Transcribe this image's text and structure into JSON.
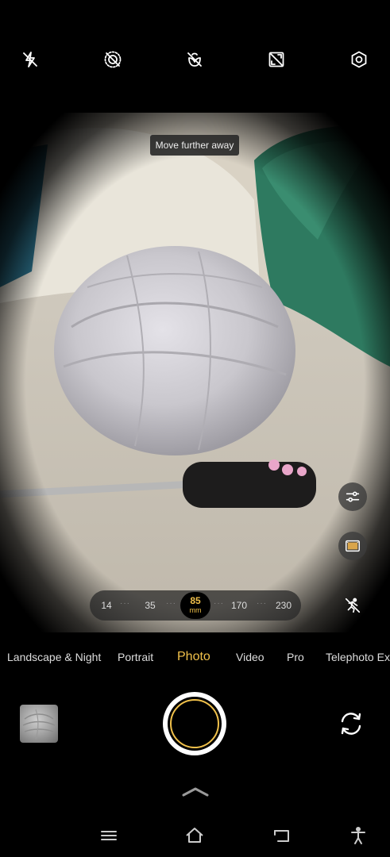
{
  "top_bar": {
    "icons": [
      "flash-off-icon",
      "live-photo-off-icon",
      "macro-off-icon",
      "aspect-ratio-icon",
      "settings-icon"
    ]
  },
  "viewfinder": {
    "tip": "Move further away",
    "side_buttons": [
      "filters-adjust-icon",
      "film-filter-icon",
      "motion-capture-icon"
    ]
  },
  "zoom": {
    "options": [
      "14",
      "35",
      "85",
      "170",
      "230"
    ],
    "selected": "85",
    "unit": "mm",
    "separator": "···"
  },
  "modes": {
    "items": [
      "Landscape & Night",
      "Portrait",
      "Photo",
      "Video",
      "Pro",
      "Telephoto Ext"
    ],
    "selected": "Photo"
  },
  "controls": {
    "gallery": "gallery-thumbnail",
    "shutter": "shutter-button",
    "switch": "switch-camera-icon"
  },
  "colors": {
    "accent": "#f0c04a",
    "background": "#000000"
  }
}
